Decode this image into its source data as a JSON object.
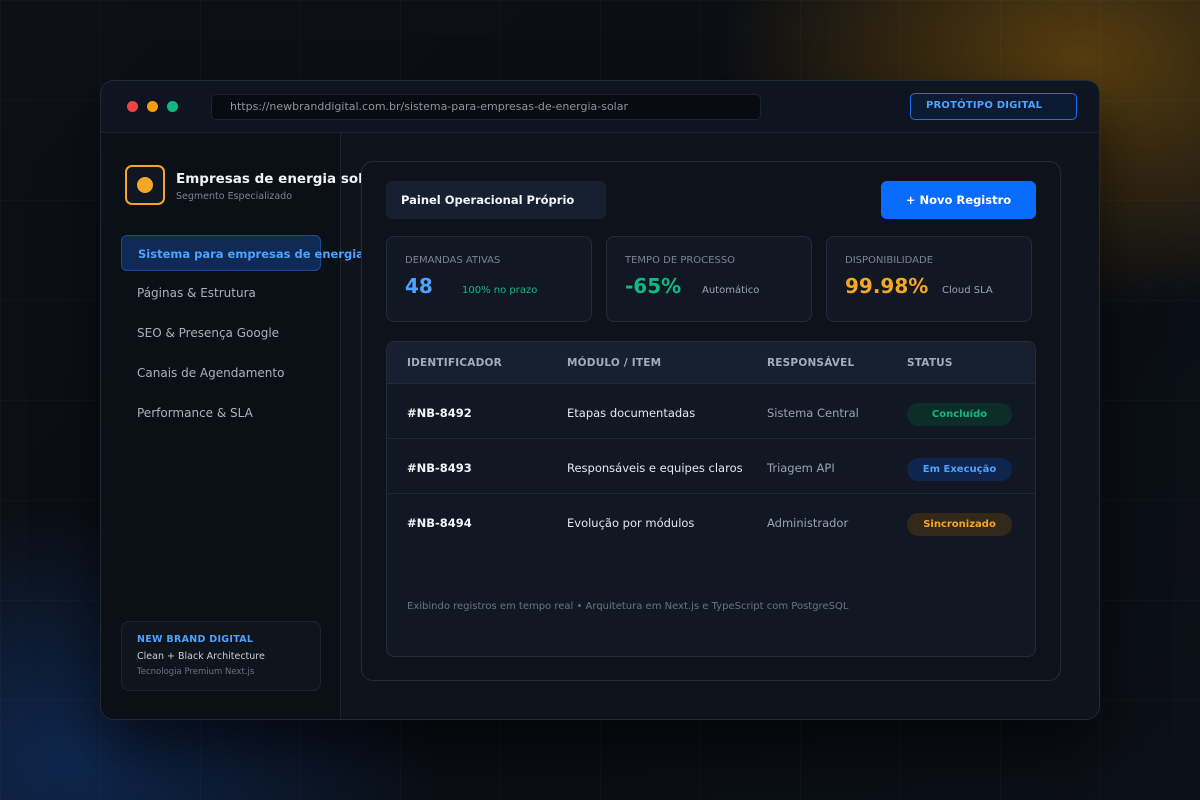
{
  "browser": {
    "url": "https://newbranddigital.com.br/sistema-para-empresas-de-energia-solar",
    "badge": "PROTÓTIPO DIGITAL"
  },
  "sidebar": {
    "brand_title": "Empresas de energia solar",
    "brand_subtitle": "Segmento Especializado",
    "items": [
      {
        "label": "Sistema para empresas de energia solar",
        "active": true
      },
      {
        "label": "Páginas & Estrutura",
        "active": false
      },
      {
        "label": "SEO & Presença Google",
        "active": false
      },
      {
        "label": "Canais de Agendamento",
        "active": false
      },
      {
        "label": "Performance & SLA",
        "active": false
      }
    ],
    "footer": {
      "brand": "NEW BRAND DIGITAL",
      "tagline": "Clean + Black Architecture",
      "tech": "Tecnologia Premium Next.js"
    }
  },
  "main": {
    "panel_title": "Painel Operacional Próprio",
    "new_button": "+ Novo Registro",
    "stats": [
      {
        "label": "DEMANDAS ATIVAS",
        "value": "48",
        "note": "100% no prazo",
        "value_color": "#4da3ff",
        "note_color": "#10b981"
      },
      {
        "label": "TEMPO DE PROCESSO",
        "value": "-65%",
        "note": "Automático",
        "value_color": "#10b981",
        "note_color": "#9aa3b2"
      },
      {
        "label": "DISPONIBILIDADE",
        "value": "99.98%",
        "note": "Cloud SLA",
        "value_color": "#f5a623",
        "note_color": "#9aa3b2"
      }
    ],
    "table": {
      "headers": [
        "IDENTIFICADOR",
        "MÓDULO / ITEM",
        "RESPONSÁVEL",
        "STATUS"
      ],
      "rows": [
        {
          "id": "#NB-8492",
          "module": "Etapas documentadas",
          "owner": "Sistema Central",
          "status": "Concluído",
          "status_color": "#10b981",
          "status_bg": "#0d2e28"
        },
        {
          "id": "#NB-8493",
          "module": "Responsáveis e equipes claros",
          "owner": "Triagem API",
          "status": "Em Execução",
          "status_color": "#4da3ff",
          "status_bg": "#0f254d"
        },
        {
          "id": "#NB-8494",
          "module": "Evolução por módulos",
          "owner": "Administrador",
          "status": "Sincronizado",
          "status_color": "#f5a623",
          "status_bg": "#33291a"
        }
      ],
      "footer": "Exibindo registros em tempo real • Arquitetura em Next.js e TypeScript com PostgreSQL"
    }
  }
}
